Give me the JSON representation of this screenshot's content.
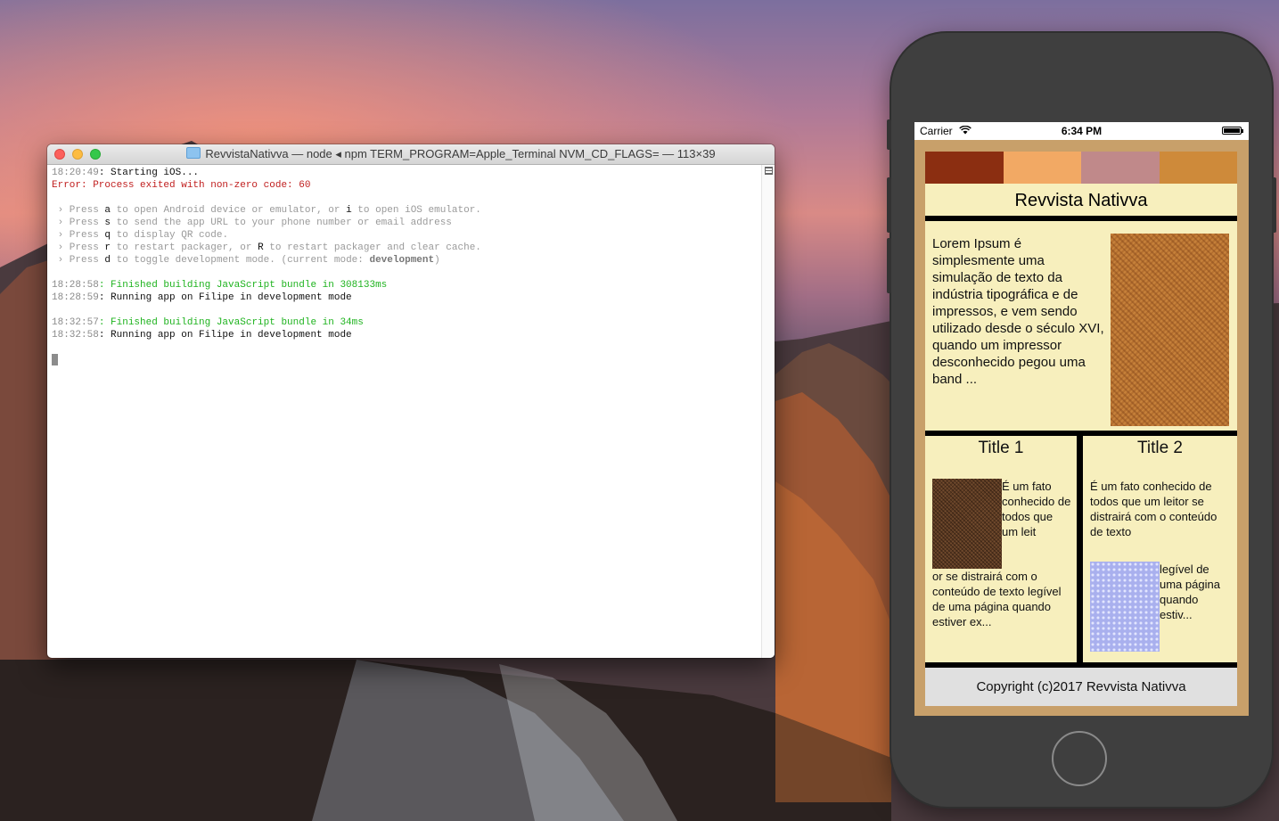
{
  "terminal": {
    "title": "RevvistaNativva — node ◂ npm TERM_PROGRAM=Apple_Terminal NVM_CD_FLAGS= — 113×39",
    "lines": {
      "l1_ts": "18:20:49",
      "l1_msg": ": Starting iOS...",
      "l2": "Error: Process exited with non-zero code: 60",
      "help": [
        {
          "pre": " › Press ",
          "key": "a",
          "post": " to open Android device or emulator, or ",
          "key2": "i",
          "post2": " to open iOS emulator."
        },
        {
          "pre": " › Press ",
          "key": "s",
          "post": " to send the app URL to your phone number or email address"
        },
        {
          "pre": " › Press ",
          "key": "q",
          "post": " to display QR code."
        },
        {
          "pre": " › Press ",
          "key": "r",
          "post": " to restart packager, or ",
          "key2": "R",
          "post2": " to restart packager and clear cache."
        },
        {
          "pre": " › Press ",
          "key": "d",
          "post": " to toggle development mode. (current mode: ",
          "bold": "development",
          "post2": ")"
        }
      ],
      "l8_ts": "18:28:58",
      "l8_msg": ": Finished building JavaScript bundle in 308133ms",
      "l9_ts": "18:28:59",
      "l9_msg": ": Running app on Filipe in development mode",
      "l11_ts": "18:32:57",
      "l11_msg": ": Finished building JavaScript bundle in 34ms",
      "l12_ts": "18:32:58",
      "l12_msg": ": Running app on Filipe in development mode"
    }
  },
  "phone": {
    "status": {
      "carrier": "Carrier",
      "time": "6:34 PM",
      "battery_level": 1.0
    },
    "app": {
      "colors": [
        "#8b2e11",
        "#f2a964",
        "#c0898a",
        "#ce8a3a"
      ],
      "title": "Revvista Nativva",
      "featured_text": "Lorem Ipsum é simplesmente uma simulação de texto da indústria tipográfica e de impressos, e vem sendo utilizado desde o século XVI, quando um impressor desconhecido pegou uma band ...",
      "col1": {
        "title": "Title 1",
        "text_side": "É um fato conhecido de todos que um leit",
        "text_below": "or se distrairá  com o conteúdo de texto legível de uma página quando estiver ex..."
      },
      "col2": {
        "title": "Title 2",
        "text_top": "É um fato conhecido de todos que um leitor se distrairá  com o conteúdo de texto",
        "text_side": " legível de uma página quando estiv..."
      },
      "footer": "Copyright (c)2017 Revvista Nativva"
    }
  }
}
